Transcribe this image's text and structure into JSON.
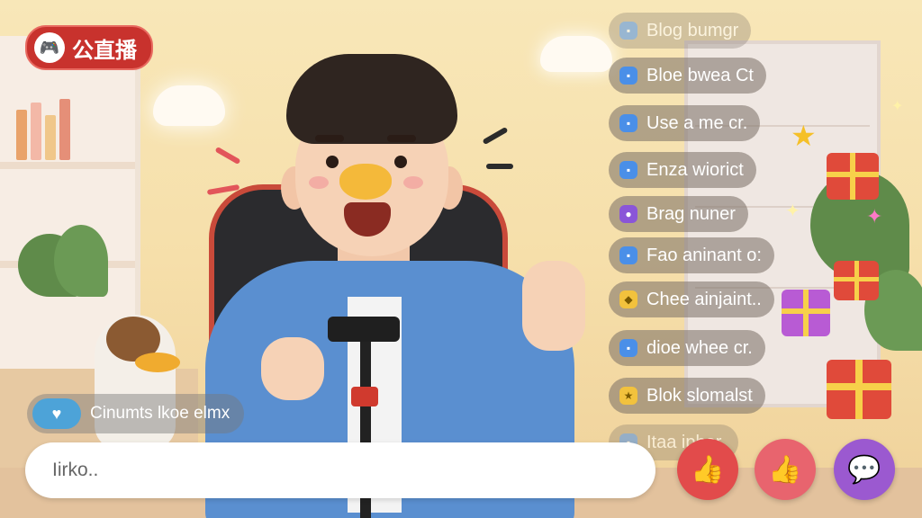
{
  "app": {
    "logo_text": "公直播"
  },
  "chat": {
    "messages": [
      {
        "text": "Blog bumgr",
        "icon": "chat-bubble-icon",
        "color": "#4a8fe8"
      },
      {
        "text": "Bloe bwea Ct",
        "icon": "chat-bubble-icon",
        "color": "#4a8fe8"
      },
      {
        "text": "Use a me cr.",
        "icon": "chat-bubble-icon",
        "color": "#4a8fe8"
      },
      {
        "text": "Enza wiorict",
        "icon": "chat-bubble-icon",
        "color": "#4a8fe8"
      },
      {
        "text": "Brag nuner",
        "icon": "game-controller-icon",
        "color": "#8a55d8"
      },
      {
        "text": "Fao aninant o:",
        "icon": "chat-bubble-icon",
        "color": "#4a8fe8"
      },
      {
        "text": "Chee ainjaint..",
        "icon": "shield-icon",
        "color": "#f2c23d"
      },
      {
        "text": "dioe whee cr.",
        "icon": "chat-bubble-icon",
        "color": "#4a8fe8"
      },
      {
        "text": "Blok slomalst",
        "icon": "star-icon",
        "color": "#f2c23d"
      },
      {
        "text": "Itaa ipher.",
        "icon": "chat-bubble-icon",
        "color": "#4a8fe8"
      }
    ],
    "notice": {
      "text": "Cinumts lkoe elmx",
      "icon": "hearts-icon"
    }
  },
  "composer": {
    "placeholder": "Iirko..",
    "value": ""
  },
  "actions": {
    "like_primary": {
      "icon": "thumbs-up-icon",
      "color": "#e24b4b"
    },
    "like_secondary": {
      "icon": "thumbs-up-icon",
      "color": "#e8646e"
    },
    "comment": {
      "icon": "chat-heart-icon",
      "color": "#9b59d0"
    }
  },
  "colors": {
    "brand": "#c8322d",
    "accent": "#4a8fe8"
  }
}
